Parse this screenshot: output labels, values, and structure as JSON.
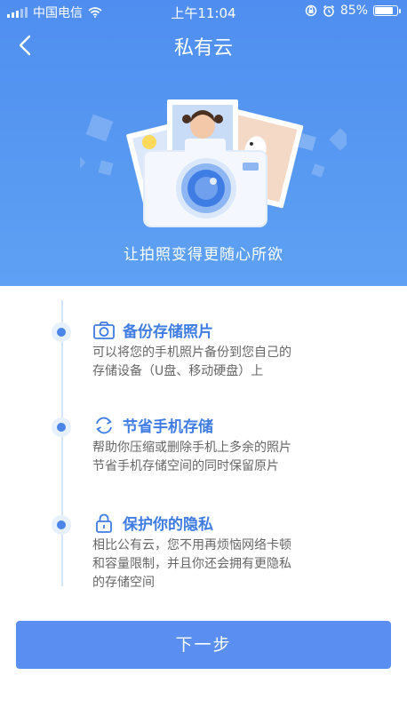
{
  "status_bar": {
    "carrier": "中国电信",
    "time": "上午11:04",
    "battery_percent": "85%",
    "battery_level": 0.85,
    "icons": [
      "signal-icon",
      "wifi-icon",
      "rotation-lock-icon",
      "alarm-icon",
      "battery-icon"
    ]
  },
  "header": {
    "title": "私有云",
    "back_icon": "chevron-left-icon"
  },
  "hero": {
    "slogan": "让拍照变得更随心所欲",
    "illustration": "camera-with-photos-illustration"
  },
  "features": [
    {
      "icon": "camera-icon",
      "title": "备份存储照片",
      "desc_lines": [
        "可以将您的手机照片备份到您自己的",
        "存储设备（U盘、移动硬盘）上"
      ]
    },
    {
      "icon": "sync-icon",
      "title": "节省手机存储",
      "desc_lines": [
        "帮助你压缩或删除手机上多余的照片",
        "节省手机存储空间的同时保留原片"
      ]
    },
    {
      "icon": "lock-icon",
      "title": "保护你的隐私",
      "desc_lines": [
        "相比公有云，您不用再烦恼网络卡顿",
        "和容量限制，并且你还会拥有更隐私",
        "的存储空间"
      ]
    }
  ],
  "next_button": {
    "label": "下一步"
  },
  "colors": {
    "accent": "#4f8ef0",
    "button": "#5a8ef0",
    "feature_title": "#3f7ce3",
    "text_secondary": "#666666"
  }
}
